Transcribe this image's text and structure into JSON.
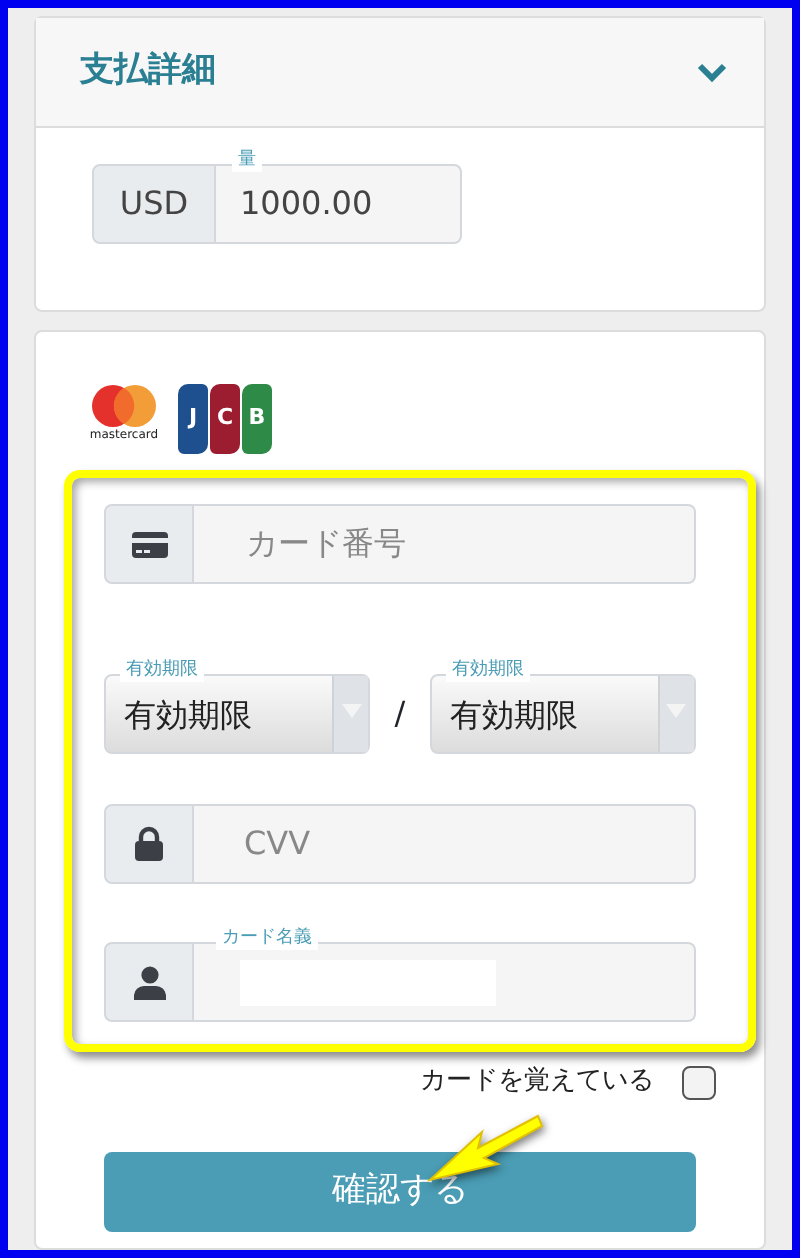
{
  "payment_panel": {
    "title": "支払詳細",
    "expanded": true,
    "currency": "USD",
    "amount_label": "量",
    "amount": "1000.00"
  },
  "card_logos": [
    {
      "kind": "mastercard",
      "caption": "mastercard"
    },
    {
      "kind": "jcb",
      "letters": [
        "J",
        "C",
        "B"
      ]
    }
  ],
  "card_form": {
    "card_number": {
      "placeholder": "カード番号"
    },
    "expiry": [
      {
        "label": "有効期限",
        "value": "有効期限"
      },
      {
        "label": "有効期限",
        "value": "有効期限"
      }
    ],
    "expiry_separator": "/",
    "cvv": {
      "placeholder": "CVV"
    },
    "card_holder": {
      "label": "カード名義",
      "redacted": true
    }
  },
  "remember_card": {
    "label": "カードを覚えている",
    "checked": false
  },
  "confirm_button": "確認する",
  "annotations": {
    "highlight_box": true,
    "arrow": true
  }
}
